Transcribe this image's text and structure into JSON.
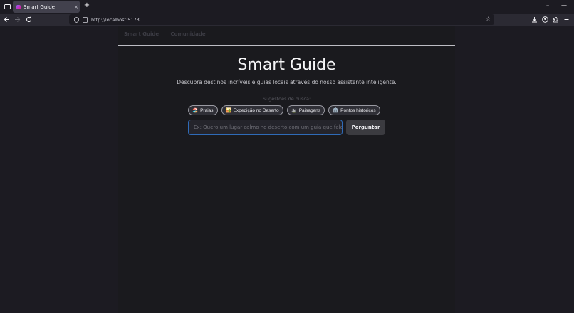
{
  "browser": {
    "tab_title": "Smart Guide",
    "tab_close": "×",
    "new_tab": "+",
    "url": "http://localhost:5173",
    "list_tabs": "⌄",
    "minimize": "—"
  },
  "nav": {
    "brand": "Smart Guide",
    "separator": "|",
    "community": "Comunidade"
  },
  "hero": {
    "title": "Smart Guide",
    "subtitle": "Descubra destinos incríveis e guias locais através do nosso assistente inteligente."
  },
  "suggestions": {
    "label": "Sugestões de busca:",
    "chips": [
      {
        "emoji": "🏖️",
        "label": "Praias"
      },
      {
        "emoji": "🏜️",
        "label": "Expedição no Deserto"
      },
      {
        "emoji": "⛰️",
        "label": "Paisagens"
      },
      {
        "emoji": "🏛️",
        "label": "Pontos históricos"
      }
    ]
  },
  "search": {
    "placeholder": "Ex: Quero um lugar calmo no deserto com um guia que fale i",
    "value": "",
    "button_label": "Perguntar"
  },
  "colors": {
    "page_bg": "#1c1b22",
    "container_bg": "#1a1a1e",
    "input_border": "#2f6bb8",
    "button_bg": "#3b3b40"
  }
}
